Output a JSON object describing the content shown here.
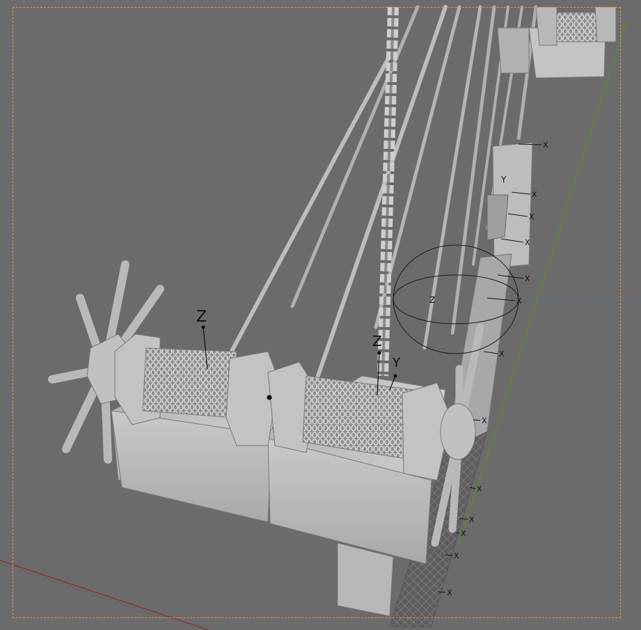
{
  "viewport": {
    "background": "#6b6b6b",
    "camera_frame_color": "#e39a3a",
    "x_axis_color": "#8f2a2a",
    "y_axis_color": "#5a8a2a"
  },
  "gizmo_labels": {
    "z_main": "Z",
    "z_second": "Z",
    "y_second": "Y",
    "z_third": "Z",
    "y_third": "Y",
    "x_marker": "X"
  },
  "icons": [
    "spiked-wheel-icon",
    "chain-drum-icon",
    "empty-axis-icon"
  ]
}
